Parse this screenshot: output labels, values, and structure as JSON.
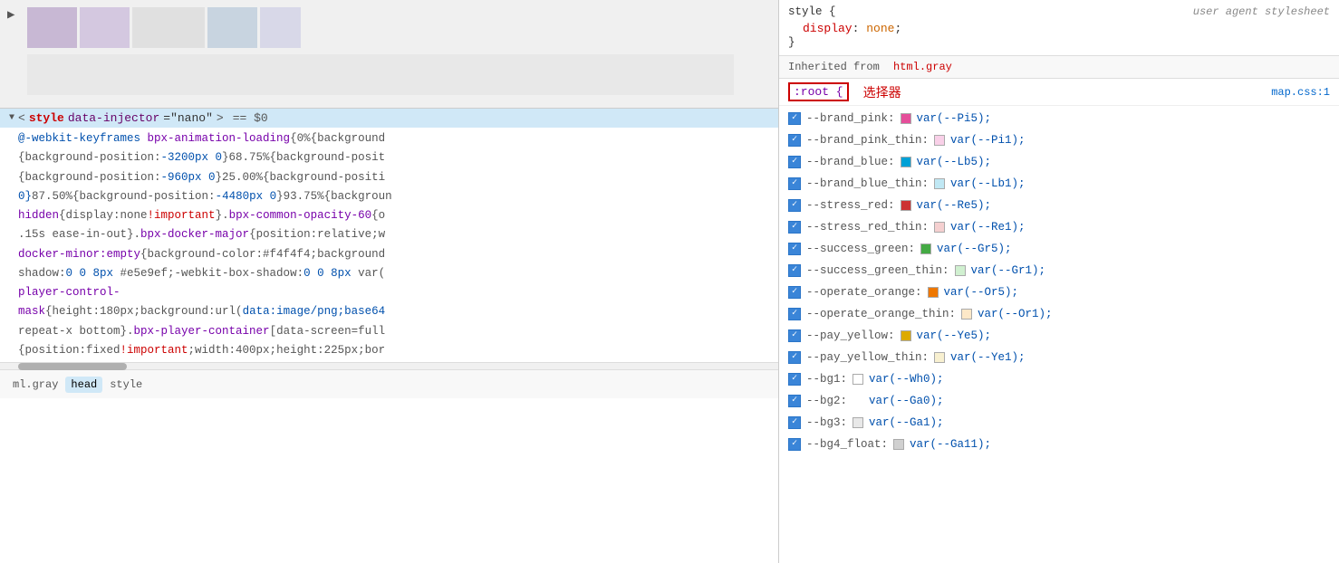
{
  "left_panel": {
    "selected_element": {
      "tag": "style",
      "attr_name": "data-injector",
      "attr_value": "\"nano\"",
      "dollar": "== $0",
      "triangle": "▼"
    },
    "code_lines": [
      {
        "text": "@-webkit-keyframes ",
        "parts": [
          {
            "t": "blue",
            "v": "@-webkit-keyframes "
          },
          {
            "t": "purple",
            "v": "bpx-animation-loading"
          },
          {
            "t": "gray",
            "v": "{0%{background"
          }
        ]
      },
      {
        "text": "{background-position:-3200px 0}68.75%{background-posit",
        "parts": [
          {
            "t": "gray",
            "v": "{"
          },
          {
            "t": "gray",
            "v": "background-position:"
          },
          {
            "t": "blue",
            "v": "-3200px 0"
          },
          {
            "t": "gray",
            "v": "}68.75%{background-posit"
          }
        ]
      },
      {
        "text": "{background-position:-960px 0}25.00%{background-positi",
        "parts": [
          {
            "t": "gray",
            "v": "{"
          },
          {
            "t": "gray",
            "v": "background-position:"
          },
          {
            "t": "blue",
            "v": "-960px 0"
          },
          {
            "t": "gray",
            "v": "}25.00%{background-positi"
          }
        ]
      },
      {
        "text": "0}87.50%{background-position:-4480px 0}93.75%{backgroun",
        "parts": [
          {
            "t": "blue",
            "v": "0}"
          },
          {
            "t": "gray",
            "v": "87.50%{"
          },
          {
            "t": "gray",
            "v": "background-position:"
          },
          {
            "t": "blue",
            "v": "-4480px 0"
          },
          {
            "t": "gray",
            "v": "}93.75%{backgroun"
          }
        ]
      },
      {
        "text": "hidden{display:none!important}.bpx-common-opacity-60{o",
        "parts": [
          {
            "t": "purple",
            "v": "hidden"
          },
          {
            "t": "gray",
            "v": "{"
          },
          {
            "t": "gray",
            "v": "display:none"
          },
          {
            "t": "red",
            "v": "!important"
          },
          {
            "t": "gray",
            "v": "}."
          },
          {
            "t": "purple",
            "v": "bpx-common-opacity-60"
          },
          {
            "t": "gray",
            "v": "{o"
          }
        ]
      },
      {
        "text": ".15s ease-in-out}.bpx-docker-major{position:relative;w",
        "parts": [
          {
            "t": "gray",
            "v": ".15s ease-in-out}."
          },
          {
            "t": "purple",
            "v": "bpx-docker-major"
          },
          {
            "t": "gray",
            "v": "{position:relative;w"
          }
        ]
      },
      {
        "text": "docker-minor:empty{background-color:#f4f4f4;background-",
        "parts": [
          {
            "t": "purple",
            "v": "docker-minor:empty"
          },
          {
            "t": "gray",
            "v": "{background-color:#f4f4f4;background-"
          }
        ]
      },
      {
        "text": "shadow:0 0 8px #e5e9ef;-webkit-box-shadow:0 0 8px var(",
        "parts": [
          {
            "t": "gray",
            "v": "shadow:"
          },
          {
            "t": "blue",
            "v": "0 0 8px"
          },
          {
            "t": "gray",
            "v": " #e5e9ef;-webkit-box-shadow:"
          },
          {
            "t": "blue",
            "v": "0 0 8px"
          },
          {
            "t": "gray",
            "v": " var("
          }
        ]
      },
      {
        "text": "player-control-",
        "parts": [
          {
            "t": "purple",
            "v": "player-control-"
          }
        ]
      },
      {
        "text": "mask{height:180px;background:url(data:image/png;base64",
        "parts": [
          {
            "t": "purple",
            "v": "mask"
          },
          {
            "t": "gray",
            "v": "{"
          },
          {
            "t": "gray",
            "v": "height:180px;"
          },
          {
            "t": "gray",
            "v": "background:url("
          },
          {
            "t": "blue",
            "v": "data:image/png;base64"
          }
        ]
      },
      {
        "text": "repeat-x bottom}.bpx-player-container[data-screen=full",
        "parts": [
          {
            "t": "gray",
            "v": "repeat-x bottom}."
          },
          {
            "t": "purple",
            "v": "bpx-player-container"
          },
          {
            "t": "gray",
            "v": "[data-screen=full"
          }
        ]
      },
      {
        "text": "{position:fixed!important;width:400px;height:225px;bor",
        "parts": [
          {
            "t": "gray",
            "v": "{"
          },
          {
            "t": "gray",
            "v": "position:fixed"
          },
          {
            "t": "red",
            "v": "!important"
          },
          {
            "t": "gray",
            "v": ";width:400px;height:225px;bor"
          }
        ]
      }
    ],
    "breadcrumb": [
      {
        "label": "ml.gray",
        "active": false
      },
      {
        "label": "head",
        "active": true
      },
      {
        "label": "style",
        "active": false
      }
    ]
  },
  "right_panel": {
    "user_agent_section": {
      "source": "user agent stylesheet",
      "rule": "style {",
      "property": "display: none;",
      "closing": "}"
    },
    "inherited_section": {
      "label": "Inherited from",
      "selector": "html.gray"
    },
    "root_selector": {
      "selector": ":root {",
      "chinese_label": "选择器",
      "file_ref": "map.css:1"
    },
    "css_vars": [
      {
        "name": "--brand_pink:",
        "swatch_color": "#e54e9a",
        "value": "var(--Pi5);"
      },
      {
        "name": "--brand_pink_thin:",
        "swatch_color": "#f9d0e8",
        "value": "var(--Pi1);"
      },
      {
        "name": "--brand_blue:",
        "swatch_color": "#00a1d6",
        "value": "var(--Lb5);"
      },
      {
        "name": "--brand_blue_thin:",
        "swatch_color": "#c0e8f4",
        "value": "var(--Lb1);"
      },
      {
        "name": "--stress_red:",
        "swatch_color": "#cc3333",
        "value": "var(--Re5);"
      },
      {
        "name": "--stress_red_thin:",
        "swatch_color": "#f5d0d0",
        "value": "var(--Re1);"
      },
      {
        "name": "--success_green:",
        "swatch_color": "#44aa44",
        "value": "var(--Gr5);"
      },
      {
        "name": "--success_green_thin:",
        "swatch_color": "#d0f0d0",
        "value": "var(--Gr1);"
      },
      {
        "name": "--operate_orange:",
        "swatch_color": "#ee7700",
        "value": "var(--Or5);"
      },
      {
        "name": "--operate_orange_thin:",
        "swatch_color": "#fde8c8",
        "value": "var(--Or1);"
      },
      {
        "name": "--pay_yellow:",
        "swatch_color": "#ddaa00",
        "value": "var(--Ye5);"
      },
      {
        "name": "--pay_yellow_thin:",
        "swatch_color": "#f8f0d0",
        "value": "var(--Ye1);"
      },
      {
        "name": "--bg1:",
        "swatch_color": "#ffffff",
        "value": "var(--Wh0);"
      },
      {
        "name": "--bg2:",
        "swatch_color": "#f0f0f0",
        "value": "var(--Ga0);"
      },
      {
        "name": "--bg3:",
        "swatch_color": "#e8e8e8",
        "value": "var(--Ga1);"
      },
      {
        "name": "--bg4_float:",
        "swatch_color": "#d0d0d0",
        "value": "var(--Ga11);"
      }
    ]
  },
  "colors": {
    "selection_bg": "#d0e8f7",
    "checkbox_blue": "#3a85d8",
    "tag_red": "#cc0000",
    "attr_purple": "#660066",
    "value_blue": "#0050ad",
    "keyword_purple": "#7700aa"
  }
}
